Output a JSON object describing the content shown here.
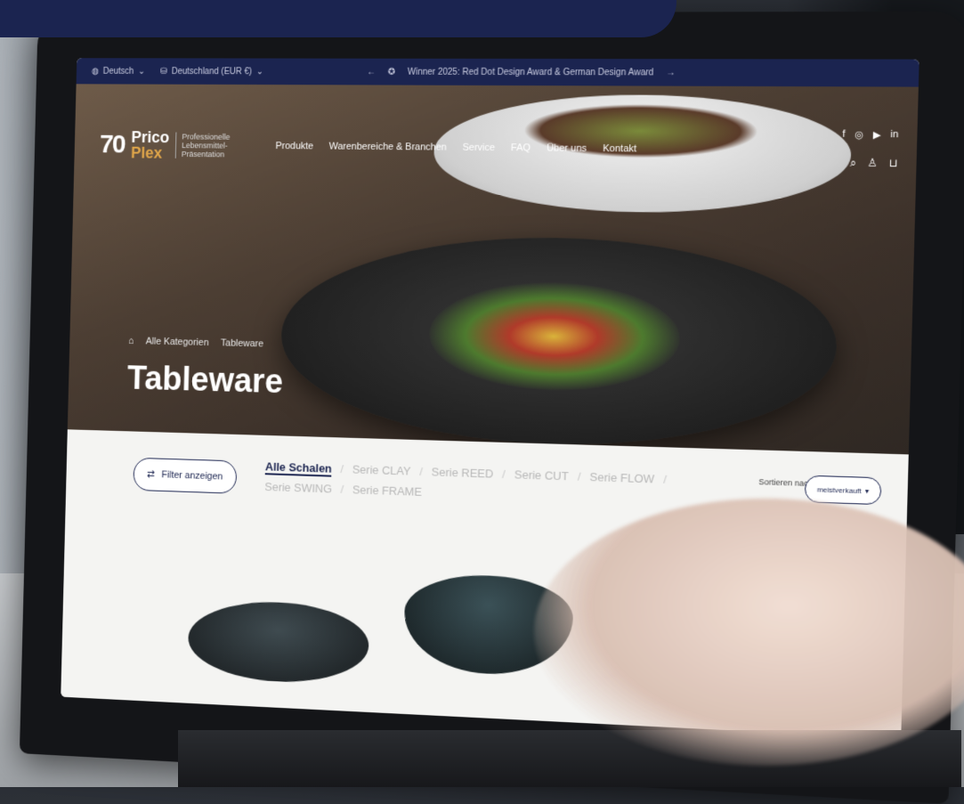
{
  "topbar": {
    "language": "Deutsch",
    "region": "Deutschland (EUR €)",
    "promo": "Winner 2025: Red Dot Design Award & German Design Award",
    "arrow_left": "←",
    "arrow_right": "→"
  },
  "logo": {
    "mark": "70",
    "name_line1": "Prico",
    "name_line2": "Plex",
    "tagline": "Professionelle Lebensmittel-Präsentation"
  },
  "nav": [
    "Produkte",
    "Warenbereiche & Branchen",
    "Service",
    "FAQ",
    "Über uns",
    "Kontakt"
  ],
  "breadcrumb": [
    "Alle Kategorien",
    "Tableware"
  ],
  "page_title": "Tableware",
  "filter": {
    "label": "Filter anzeigen"
  },
  "tabs": [
    "Alle Schalen",
    "Serie CLAY",
    "Serie REED",
    "Serie CUT",
    "Serie FLOW",
    "Serie SWING",
    "Serie FRAME"
  ],
  "sort": {
    "label": "Sortieren nach:",
    "value": "meistverkauft"
  },
  "colors": {
    "navy": "#1b2450",
    "accent": "#e0a64a"
  }
}
